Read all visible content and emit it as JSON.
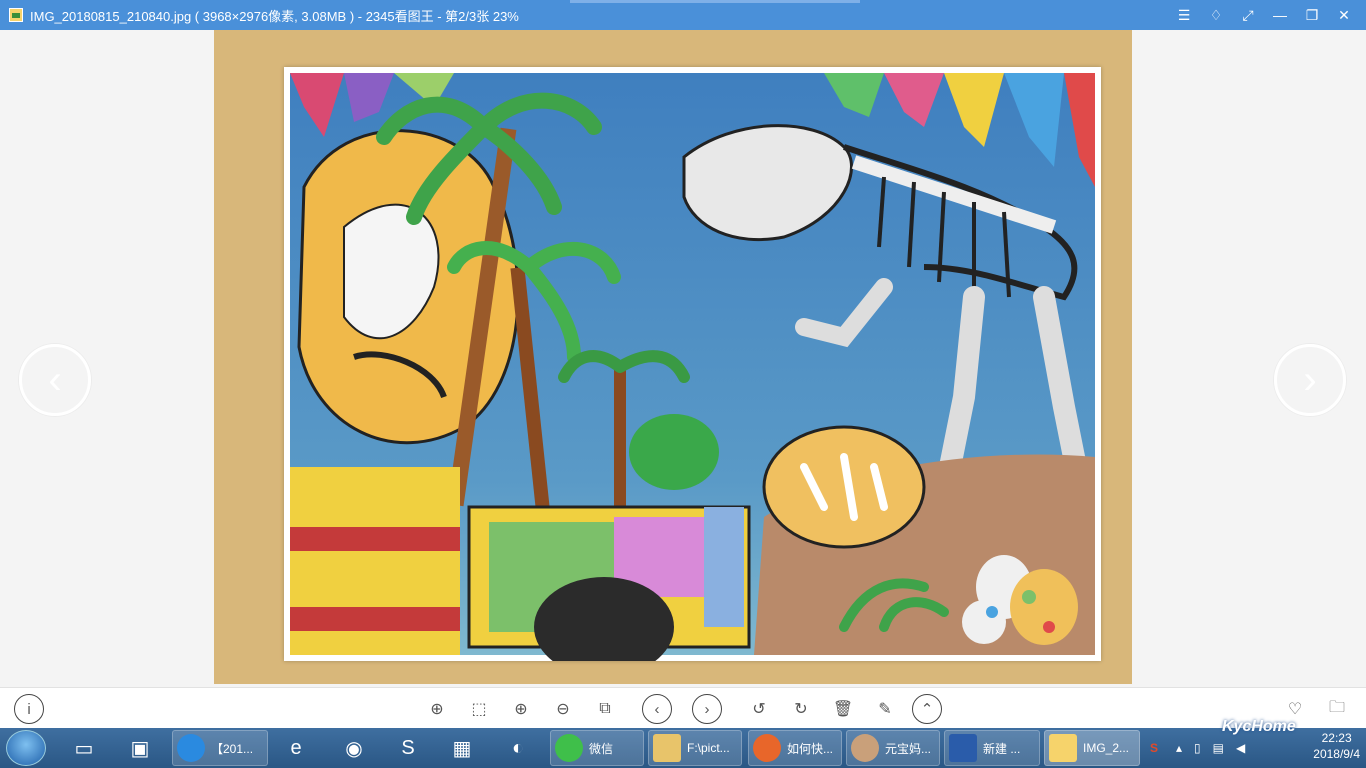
{
  "titlebar": {
    "title": "IMG_20180815_210840.jpg ( 3968×2976像素, 3.08MB ) - 2345看图王 - 第2/3张 23%",
    "buttons": [
      "menu",
      "skin",
      "fullscreen",
      "minimize",
      "restore",
      "close"
    ]
  },
  "toolbar": {
    "info_icon": "info-icon",
    "tools": [
      "pin",
      "fit-window",
      "zoom-in",
      "zoom-out",
      "actual-size",
      "previous",
      "next",
      "rotate-left",
      "rotate-right",
      "delete",
      "edit",
      "more"
    ],
    "right_tools": [
      "favorite",
      "open-folder"
    ]
  },
  "taskbar": {
    "tasks": [
      {
        "label": "【201..."
      },
      {
        "label": "微信"
      },
      {
        "label": "F:\\pict..."
      },
      {
        "label": "如何快..."
      },
      {
        "label": "元宝妈..."
      },
      {
        "label": "新建 ..."
      },
      {
        "label": "IMG_2..."
      }
    ],
    "clock_date": "2018/9/4",
    "clock_time": "22:23"
  },
  "watermark": "KycHome"
}
